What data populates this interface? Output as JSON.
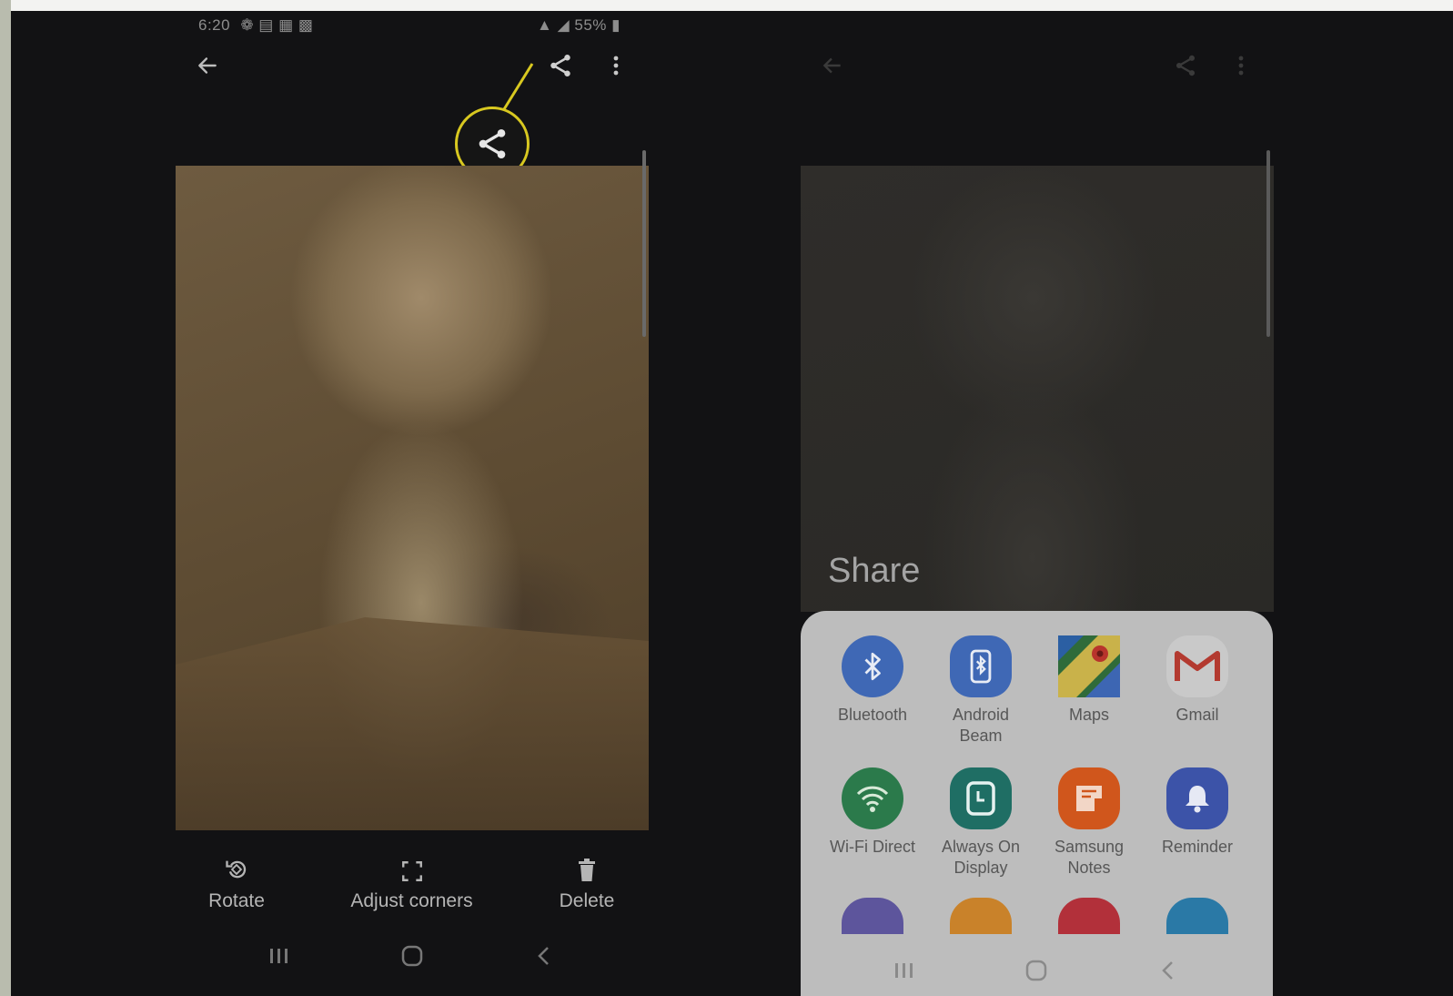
{
  "status_bar": {
    "time": "6:20",
    "battery": "55%"
  },
  "viewer_actions": [
    {
      "label": "Rotate",
      "icon": "rotate-icon"
    },
    {
      "label": "Adjust corners",
      "icon": "adjust-corners-icon"
    },
    {
      "label": "Delete",
      "icon": "trash-icon"
    }
  ],
  "share_sheet": {
    "title": "Share",
    "apps": [
      {
        "label": "Bluetooth",
        "icon": "bluetooth-icon",
        "color": "#3f68b5"
      },
      {
        "label": "Android Beam",
        "icon": "android-beam-icon",
        "color": "#3f68b5"
      },
      {
        "label": "Maps",
        "icon": "maps-icon",
        "color": "#2f6b3a"
      },
      {
        "label": "Gmail",
        "icon": "gmail-icon",
        "color": "#e0e0e0"
      },
      {
        "label": "Wi-Fi Direct",
        "icon": "wifi-direct-icon",
        "color": "#2b7a4b"
      },
      {
        "label": "Always On Display",
        "icon": "always-on-display-icon",
        "color": "#1f6e64"
      },
      {
        "label": "Samsung Notes",
        "icon": "samsung-notes-icon",
        "color": "#d0561c"
      },
      {
        "label": "Reminder",
        "icon": "reminder-icon",
        "color": "#3c53a8"
      }
    ]
  },
  "colors": {
    "highlight": "#d8c820",
    "background": "#121214"
  }
}
